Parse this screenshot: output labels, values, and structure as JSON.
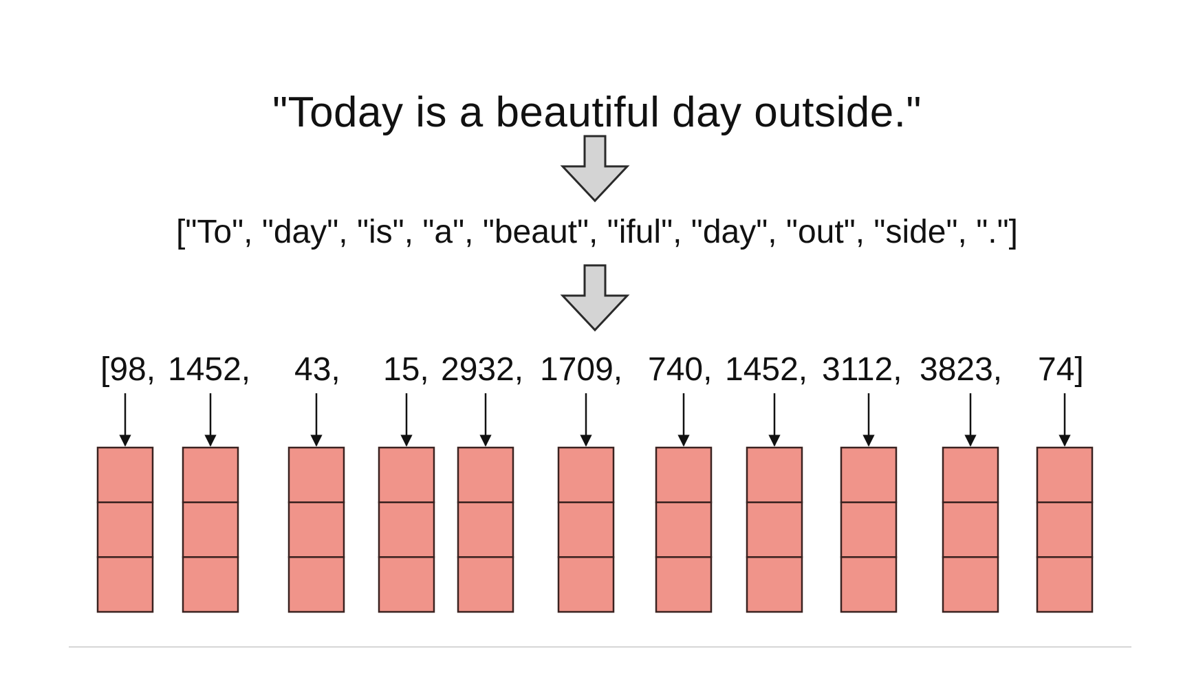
{
  "sentence": "\"Today is a beautiful day outside.\"",
  "tokens_text": "[\"To\", \"day\", \"is\", \"a\", \"beaut\", \"iful\", \"day\", \"out\", \"side\", \".\"]",
  "ids": [
    {
      "text": "[98,",
      "value": 98
    },
    {
      "text": "1452,",
      "value": 1452
    },
    {
      "text": "43,",
      "value": 43
    },
    {
      "text": "15,",
      "value": 15
    },
    {
      "text": "2932,",
      "value": 2932
    },
    {
      "text": "1709,",
      "value": 1709
    },
    {
      "text": "740,",
      "value": 740
    },
    {
      "text": "1452,",
      "value": 1452
    },
    {
      "text": "3112,",
      "value": 3112
    },
    {
      "text": "3823,",
      "value": 3823
    },
    {
      "text": "74]",
      "value": 74
    }
  ],
  "colors": {
    "embedding_fill": "#f0948a",
    "embedding_stroke": "#3a2220",
    "flow_arrow_fill": "#d4d4d4",
    "flow_arrow_stroke": "#2a2a2a",
    "text": "#111111",
    "separator": "#d6d6d6"
  },
  "embedding_cells_per_vector": 3
}
